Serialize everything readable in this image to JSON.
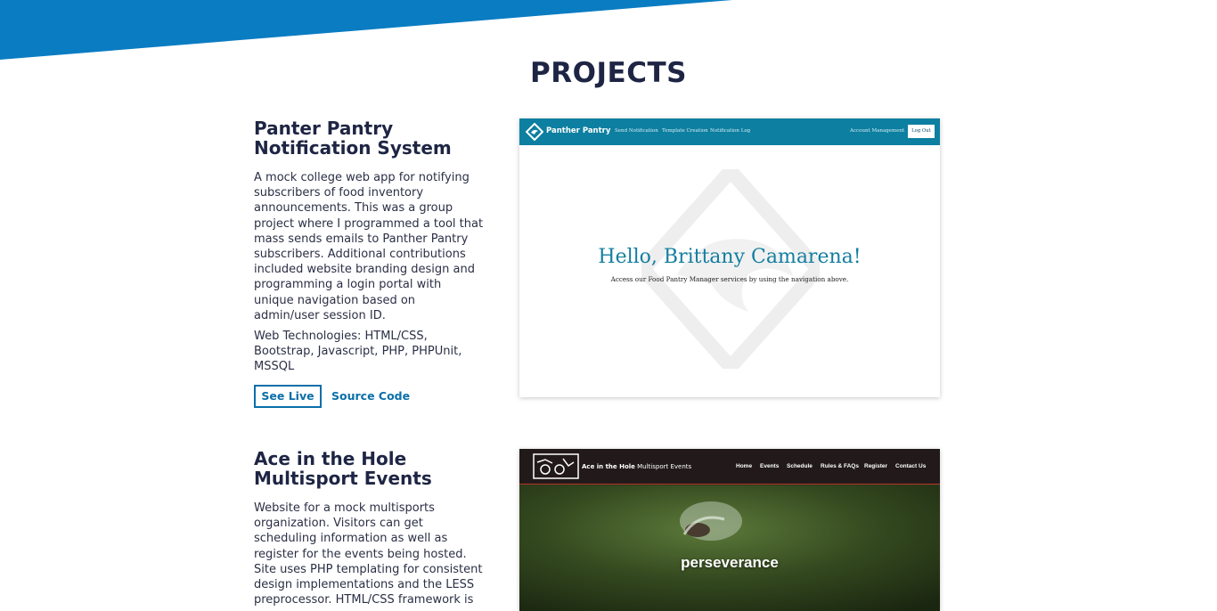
{
  "colors": {
    "banner": "#0a7cc2",
    "heading": "#1e2544",
    "accent": "#0a6fa8"
  },
  "page": {
    "section_title": "PROJECTS"
  },
  "projects": [
    {
      "name": "Panter Pantry Notification System",
      "description": "A mock college web app for notifying subscribers of food inventory announcements. This was a group project where I programmed a tool that mass sends emails to Panther Pantry subscribers. Additional contributions included website branding design and programming a login portal with unique navigation based on admin/user session ID.",
      "tech": "Web Technologies: HTML/CSS, Bootstrap, Javascript, PHP, PHPUnit, MSSQL",
      "live_label": "See Live",
      "source_label": "Source Code",
      "screenshot": {
        "brand": "Panther Pantry",
        "nav_links": [
          "Send Notification",
          "Template Creation",
          "Notification Log"
        ],
        "account_link": "Account Management",
        "logout_label": "Log Out",
        "greeting": "Hello, Brittany Camarena!",
        "subtext": "Access our Food Pantry Manager services by using the navigation above."
      }
    },
    {
      "name": "Ace in the Hole Multisport Events",
      "description": "Website for a mock multisports organization. Visitors can get scheduling information as well as register for the events being hosted. Site uses PHP templating for consistent design implementations and the LESS preprocessor. HTML/CSS framework is",
      "screenshot": {
        "brand_bold": "Ace in the Hole",
        "brand_rest": " Multisport Events",
        "nav_links": [
          "Home",
          "Events",
          "Schedule",
          "Rules & FAQs",
          "Register",
          "Contact Us"
        ],
        "tagline": "perseverance"
      }
    }
  ]
}
